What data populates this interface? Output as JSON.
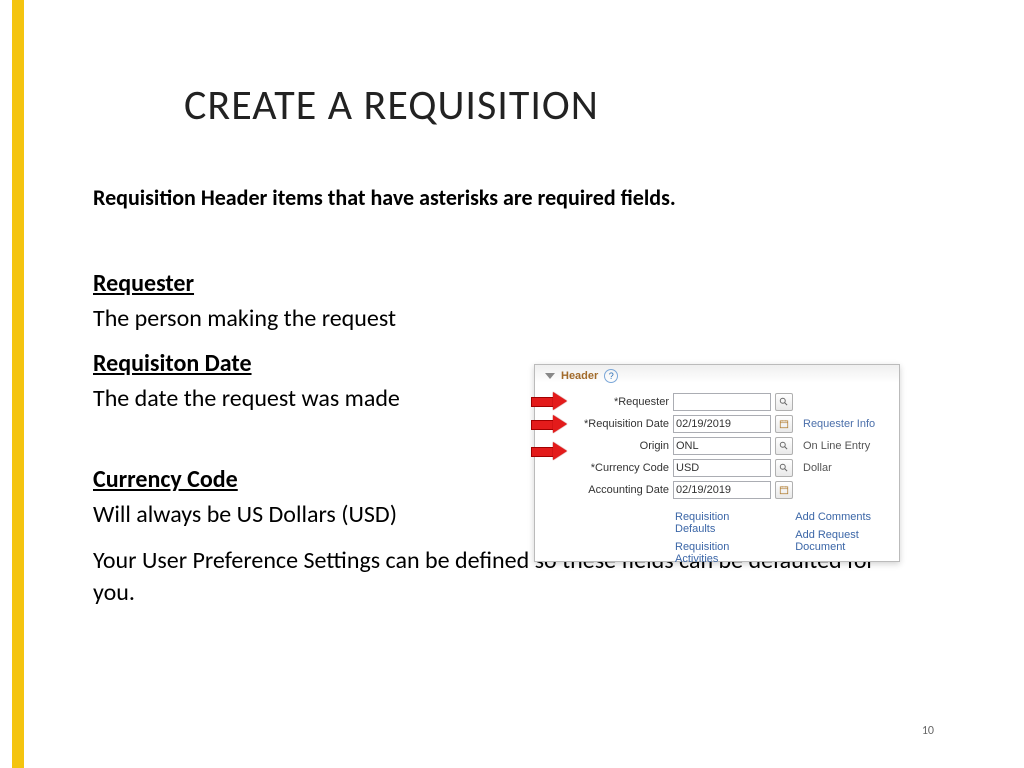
{
  "title": "CREATE A REQUISITION",
  "intro": "Requisition Header items that have asterisks are required fields.",
  "sections": {
    "requester": {
      "title": "Requester",
      "body": "The person making the request"
    },
    "reqdate": {
      "title": "Requisiton Date",
      "body": "The date the request was made"
    },
    "currency": {
      "title": "Currency Code",
      "body": "Will always be US Dollars (USD)"
    }
  },
  "note": "Your User Preference Settings can be defined so these fields can be defaulted for you.",
  "page_number": "10",
  "shot": {
    "header_label": "Header",
    "help_glyph": "?",
    "rows": {
      "requester": {
        "label": "*Requester",
        "value": ""
      },
      "requisition_date": {
        "label": "*Requisition Date",
        "value": "02/19/2019",
        "side_link": "Requester Info"
      },
      "origin": {
        "label": "Origin",
        "value": "ONL",
        "side_text": "On Line Entry"
      },
      "currency_code": {
        "label": "*Currency Code",
        "value": "USD",
        "side_text": "Dollar"
      },
      "accounting_date": {
        "label": "Accounting Date",
        "value": "02/19/2019"
      }
    },
    "links": {
      "requisition_defaults": "Requisition Defaults",
      "requisition_activities": "Requisition Activities",
      "add_comments": "Add Comments",
      "add_request_document": "Add Request Document"
    }
  }
}
